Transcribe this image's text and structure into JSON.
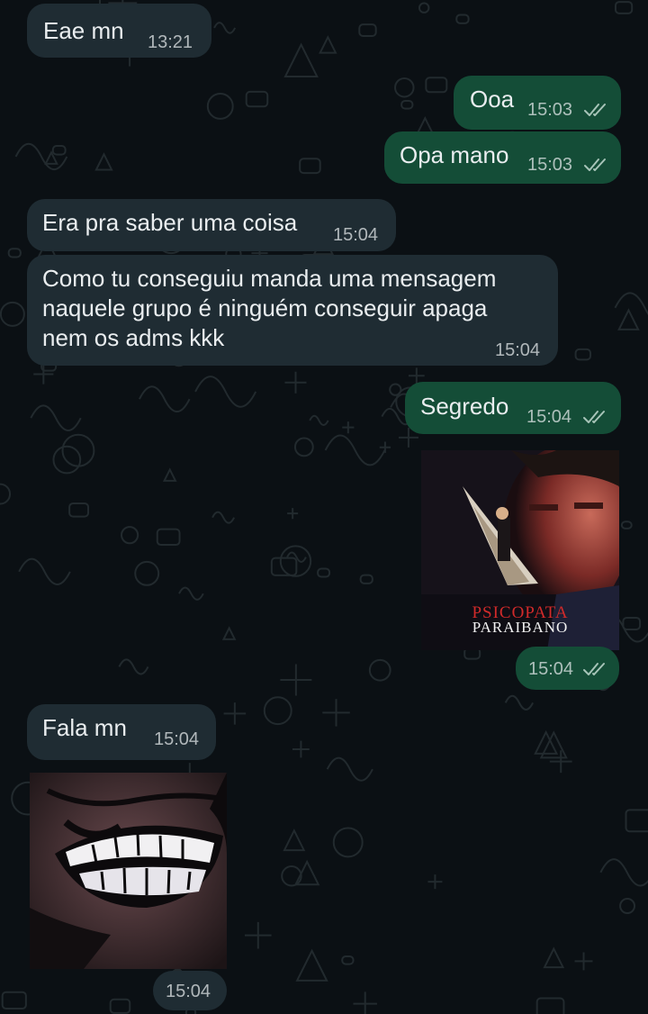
{
  "colors": {
    "background": "#0b1014",
    "incoming_bubble": "#1f2c33",
    "outgoing_bubble": "#144d37",
    "read_ticks": "#a7c4b8"
  },
  "messages": [
    {
      "direction": "in",
      "text": "Eae mn",
      "time": "13:21"
    },
    {
      "direction": "out",
      "text": "Ooa",
      "time": "15:03",
      "status": "read",
      "status_icon": "double-check-icon"
    },
    {
      "direction": "out",
      "text": "Opa mano",
      "time": "15:03",
      "status": "read",
      "status_icon": "double-check-icon"
    },
    {
      "direction": "in",
      "text": "Era pra saber uma coisa",
      "time": "15:04"
    },
    {
      "direction": "in",
      "lines": [
        "Como tu conseguiu manda uma mensagem",
        "naquele grupo é ninguém conseguir apaga",
        "nem os adms kkk"
      ],
      "time": "15:04"
    },
    {
      "direction": "out",
      "text": "Segredo",
      "time": "15:04",
      "status": "read",
      "status_icon": "double-check-icon"
    },
    {
      "direction": "out",
      "media": "sticker",
      "sticker_lines": [
        "PSICOPATA",
        "PARAIBANO"
      ],
      "time": "15:04",
      "status": "read",
      "status_icon": "double-check-icon"
    },
    {
      "direction": "in",
      "text": "Fala mn",
      "time": "15:04"
    },
    {
      "direction": "in",
      "media": "sticker",
      "time": "15:04"
    }
  ]
}
